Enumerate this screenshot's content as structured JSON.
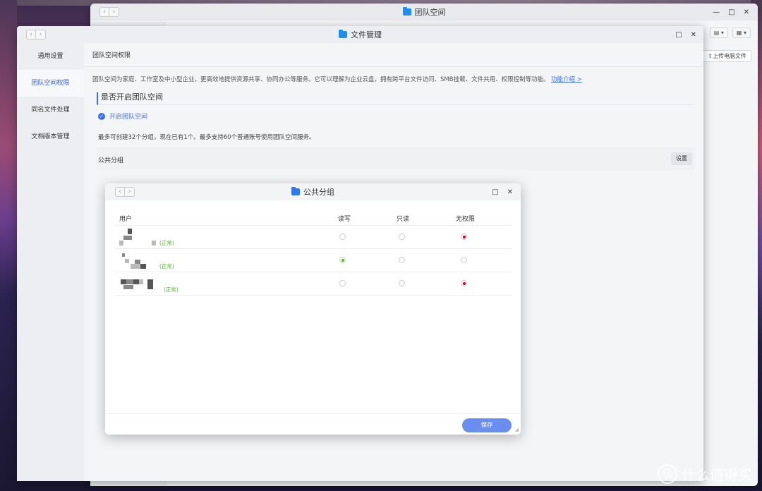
{
  "back_window": {
    "title": "团队空间",
    "nav_back": "‹",
    "nav_forward": "›",
    "minimize": "—",
    "maximize": "□",
    "close": "✕",
    "toolbar": {
      "view_btn": "▤ ▾",
      "grid_btn": "▦ ▾"
    },
    "upload_label": "⇪上传电脑文件"
  },
  "main_window": {
    "title": "文件管理",
    "nav_back": "‹",
    "nav_forward": "›",
    "maximize": "□",
    "close": "✕",
    "sidebar": {
      "items": [
        {
          "label": "通用设置",
          "active": false
        },
        {
          "label": "团队空间权限",
          "active": true
        },
        {
          "label": "同名文件处理",
          "active": false
        },
        {
          "label": "文档版本管理",
          "active": false
        }
      ]
    },
    "content": {
      "header": "团队空间权限",
      "description": "团队空间为家庭、工作室及中小型企业，更高效地提供资源共享、协同办公等服务。它可以理解为企业云盘，拥有跨平台文件访问、SMB挂载、文件共用、权限控制等功能。",
      "link": "功能介绍 >",
      "section_title": "是否开启团队空间",
      "enable_label": "开启团队空间",
      "note": "最多可创建32个分组，现在已有1个。最多支持60个普通账号使用团队空间服务。",
      "group_name": "公共分组",
      "settings_button": "设置"
    }
  },
  "dialog": {
    "title": "公共分组",
    "nav_back": "‹",
    "nav_forward": "›",
    "maximize": "□",
    "close": "✕",
    "columns": [
      "用户",
      "读写",
      "只读",
      "无权限"
    ],
    "rows": [
      {
        "status": "(正常)",
        "permission": "无权限"
      },
      {
        "status": "(正常)",
        "permission": "读写"
      },
      {
        "status": "(正常)",
        "permission": "无权限"
      }
    ],
    "save_button": "保存",
    "grip": "◢"
  },
  "watermark": {
    "logo": "值",
    "text": "什么值得买"
  },
  "colors": {
    "accent": "#3b6df0",
    "save_button": "#6a8ef0",
    "status_green": "#52b82a",
    "radio_red": "#d0021b"
  }
}
